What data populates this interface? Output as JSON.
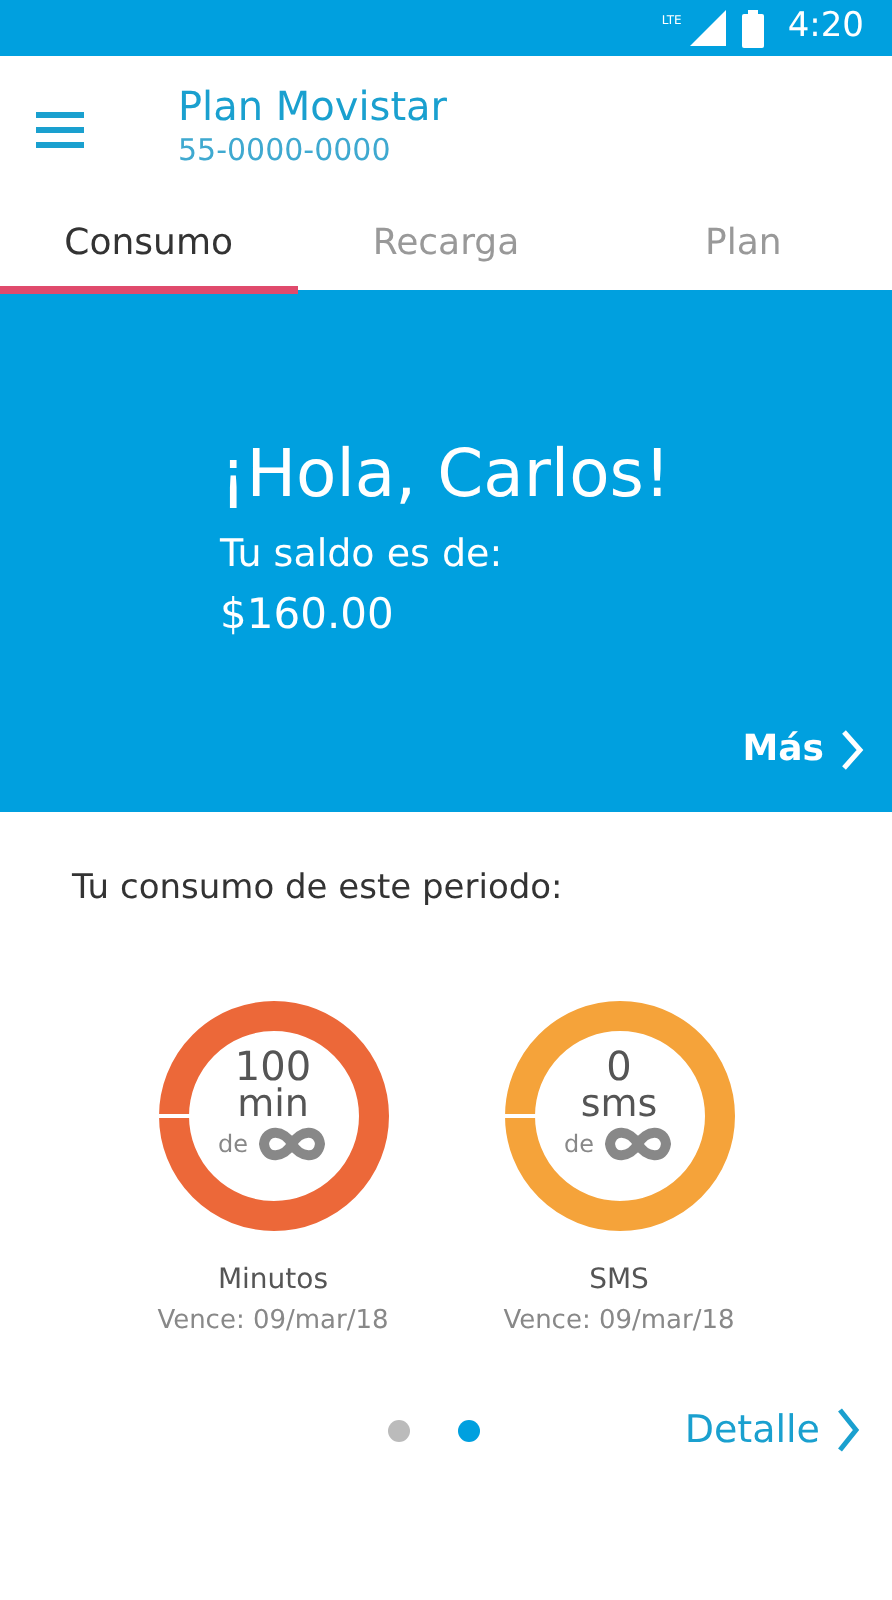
{
  "status_bar": {
    "network": "LTE",
    "time": "4:20"
  },
  "header": {
    "title": "Plan Movistar",
    "subtitle": "55-0000-0000"
  },
  "tabs": [
    {
      "label": "Consumo",
      "selected": true
    },
    {
      "label": "Recarga",
      "selected": false
    },
    {
      "label": "Plan",
      "selected": false
    }
  ],
  "hero": {
    "greeting": "¡Hola, Carlos!",
    "balance_label": "Tu saldo es de:",
    "balance": "$160.00",
    "more_link": "Más"
  },
  "usage": {
    "heading": "Tu consumo de este periodo:",
    "gauges": [
      {
        "amount": "100",
        "unit": "min",
        "of": "de",
        "name": "Minutos",
        "expires": "Vence: 09/mar/18",
        "color": "#ec6839"
      },
      {
        "amount": "0",
        "unit": "sms",
        "of": "de",
        "name": "SMS",
        "expires": "Vence: 09/mar/18",
        "color": "#f5a33a"
      }
    ],
    "pages": [
      {
        "selected": false
      },
      {
        "selected": true
      }
    ],
    "detail_link": "Detalle"
  }
}
